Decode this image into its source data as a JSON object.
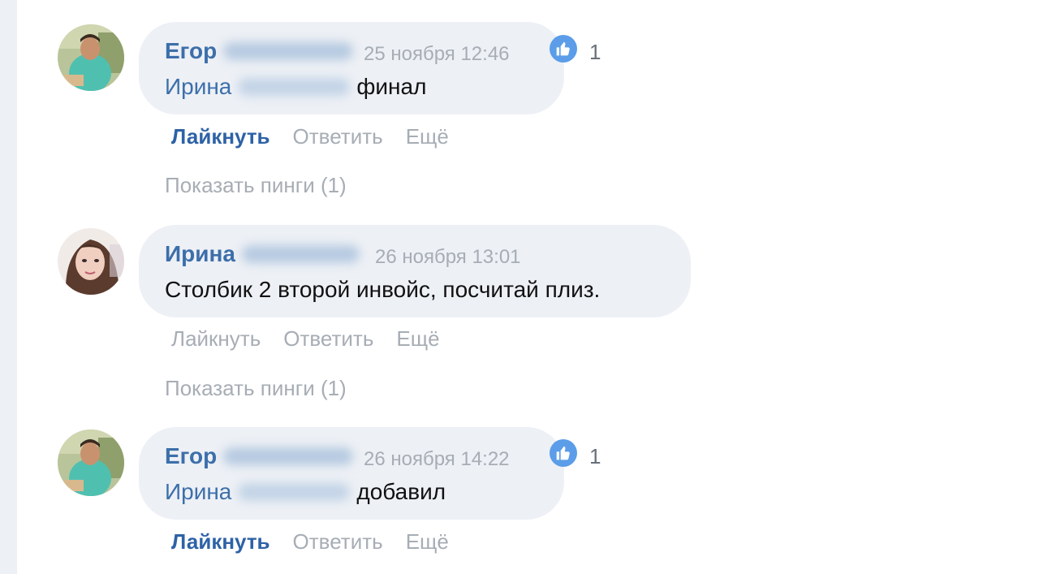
{
  "comments": [
    {
      "author_first": "Егор",
      "time": "25 ноября 12:46",
      "mention_first": "Ирина",
      "text": "финал",
      "like_count": "1",
      "actions": {
        "like": "Лайкнуть",
        "reply": "Ответить",
        "more": "Ещё"
      },
      "liked": true,
      "pings": "Показать пинги (1)"
    },
    {
      "author_first": "Ирина",
      "time": "26 ноября 13:01",
      "text": "Столбик 2 второй инвойс, посчитай плиз.",
      "actions": {
        "like": "Лайкнуть",
        "reply": "Ответить",
        "more": "Ещё"
      },
      "liked": false,
      "pings": "Показать пинги (1)"
    },
    {
      "author_first": "Егор",
      "time": "26 ноября 14:22",
      "mention_first": "Ирина",
      "text": "добавил",
      "like_count": "1",
      "actions": {
        "like": "Лайкнуть",
        "reply": "Ответить",
        "more": "Ещё"
      },
      "liked": true
    }
  ],
  "icons": {
    "like": "thumbs-up-icon"
  },
  "colors": {
    "author": "#3c6faa",
    "liked_action": "#2e62a6",
    "muted": "#a7adb5",
    "bubble": "#edf0f5",
    "like_badge": "#5b9de8"
  }
}
